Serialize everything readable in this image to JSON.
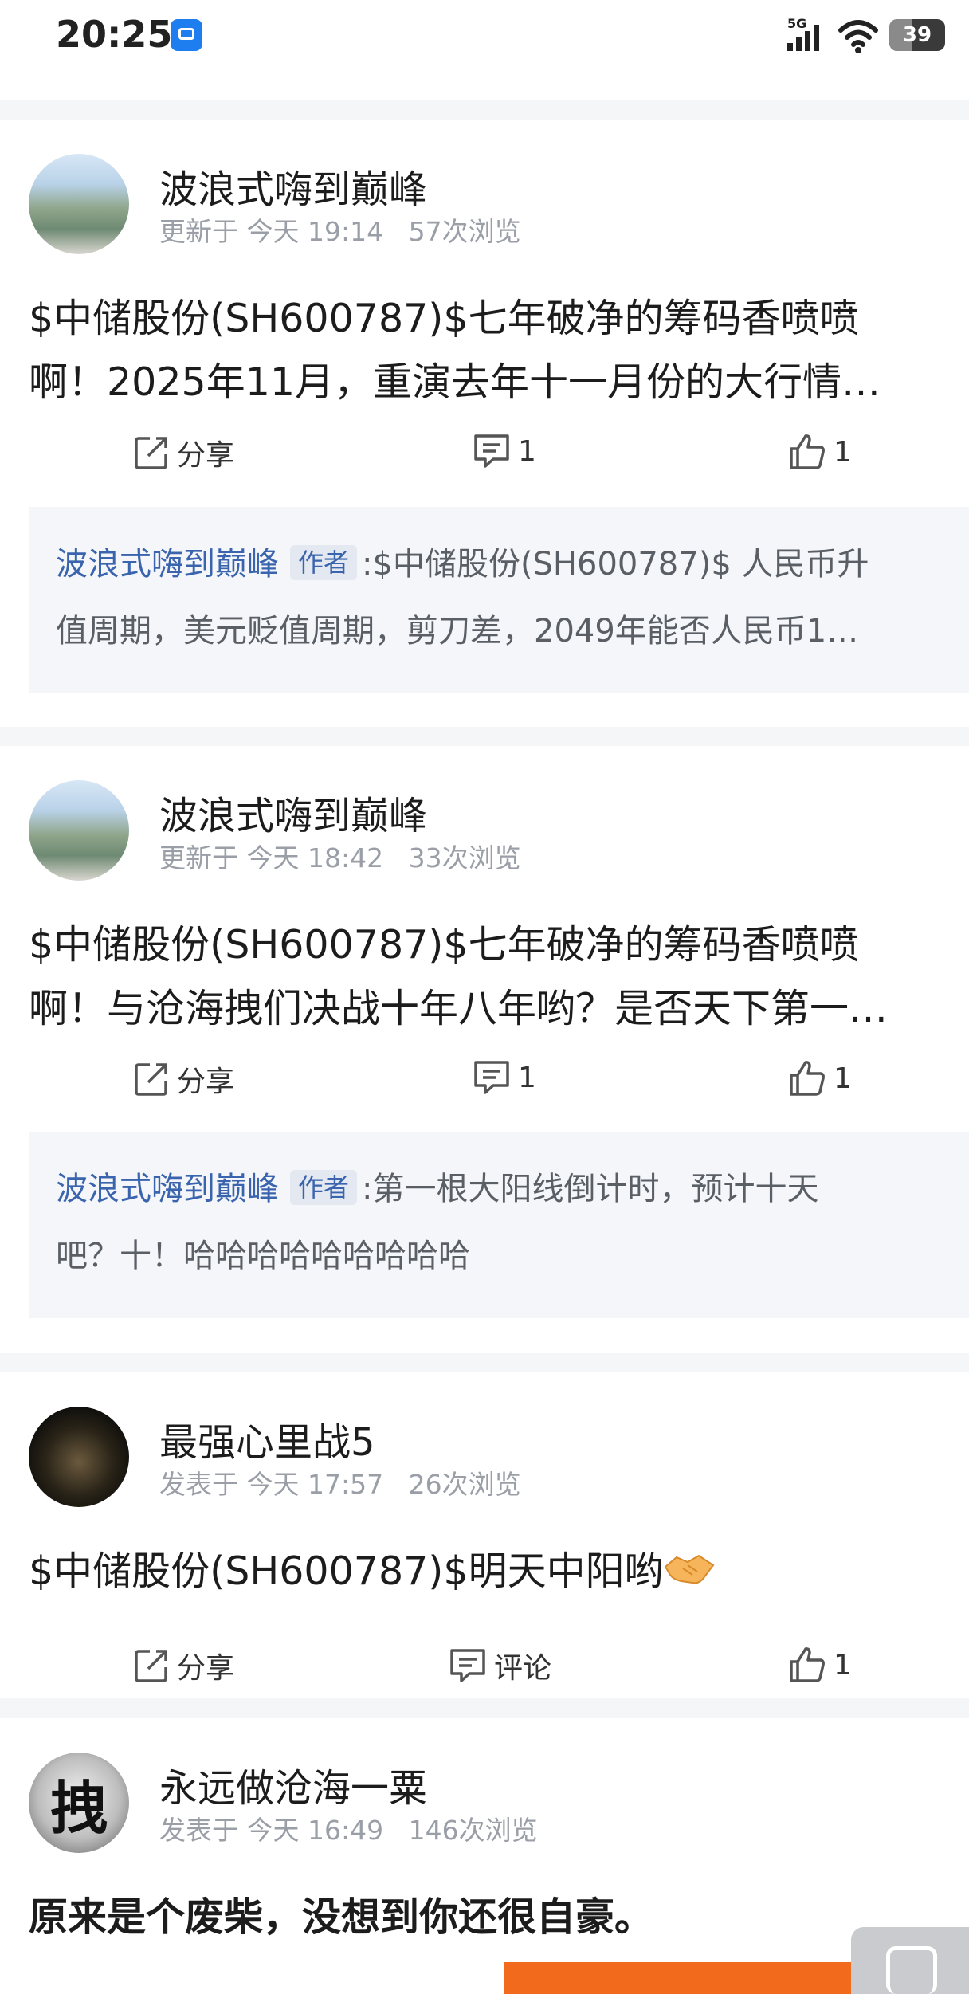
{
  "status": {
    "time": "20:25",
    "network": "5G",
    "battery": "39"
  },
  "posts": [
    {
      "author": "波浪式嗨到巅峰",
      "time_label": "更新于",
      "time": "今天 19:14",
      "views": "57次浏览",
      "content_l1": "$中储股份(SH600787)$七年破净的筹码香喷喷",
      "content_l2": "啊！2025年11月，重演去年十一月份的大行情…",
      "share": "分享",
      "comments": "1",
      "likes": "1",
      "reply": {
        "name": "波浪式嗨到巅峰",
        "tag": "作者",
        "text_l1": ":$中储股份(SH600787)$ 人民币升",
        "text_l2": "值周期，美元贬值周期，剪刀差，2049年能否人民币1…"
      }
    },
    {
      "author": "波浪式嗨到巅峰",
      "time_label": "更新于",
      "time": "今天 18:42",
      "views": "33次浏览",
      "content_l1": "$中储股份(SH600787)$七年破净的筹码香喷喷",
      "content_l2": "啊！与沧海拽们决战十年八年哟？是否天下第一…",
      "share": "分享",
      "comments": "1",
      "likes": "1",
      "reply": {
        "name": "波浪式嗨到巅峰",
        "tag": "作者",
        "text_l1": ":第一根大阳线倒计时，预计十天",
        "text_l2": "吧？十！哈哈哈哈哈哈哈哈哈"
      }
    },
    {
      "author": "最强心里战5",
      "time_label": "发表于",
      "time": "今天 17:57",
      "views": "26次浏览",
      "content_l1": "$中储股份(SH600787)$明天中阳哟",
      "share": "分享",
      "comments": "评论",
      "likes": "1"
    },
    {
      "author": "永远做沧海一粟",
      "avatar_char": "拽",
      "time_label": "发表于",
      "time": "今天 16:49",
      "views": "146次浏览",
      "content_l1": "原来是个废柴，没想到你还很自豪。"
    }
  ]
}
